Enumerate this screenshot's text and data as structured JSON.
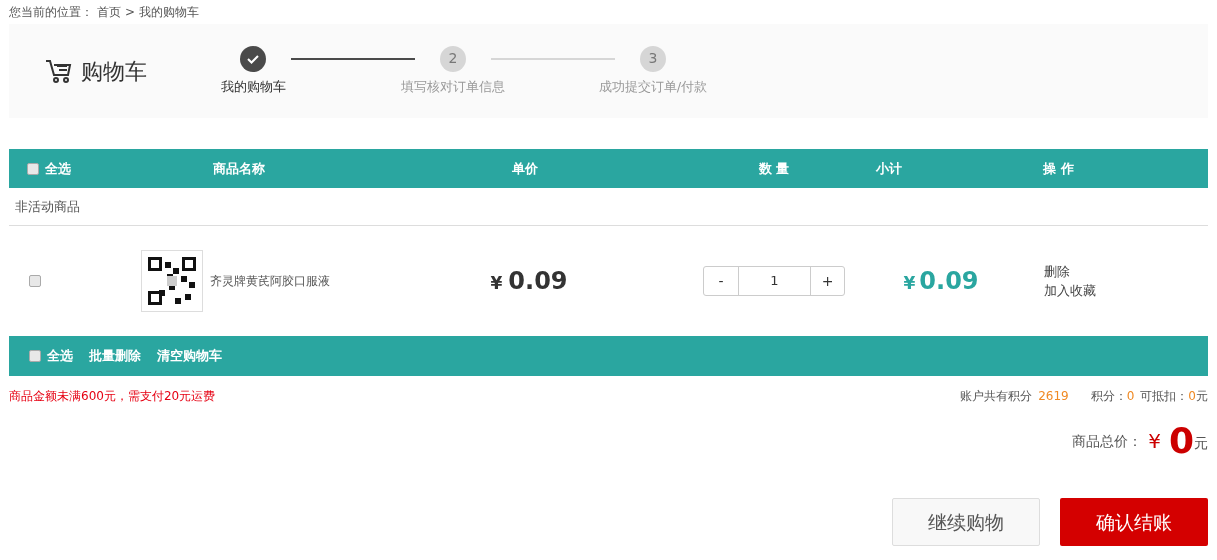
{
  "breadcrumb": {
    "label": "您当前的位置：",
    "items": [
      "首页",
      "我的购物车"
    ],
    "separator": ">"
  },
  "cart_title": "购物车",
  "steps": [
    {
      "label": "我的购物车",
      "done": true
    },
    {
      "number": "2",
      "label": "填写核对订单信息",
      "done": false
    },
    {
      "number": "3",
      "label": "成功提交订单/付款",
      "done": false
    }
  ],
  "table": {
    "select_all": {
      "label": "全选",
      "checked": false
    },
    "columns": [
      "商品名称",
      "单价",
      "数 量",
      "小计",
      "操 作"
    ]
  },
  "group_label": "非活动商品",
  "items": [
    {
      "checked": false,
      "image": {
        "kind": "picture"
      },
      "name": "齐灵牌黄芪阿胶口服液",
      "currency": "¥",
      "price": "0.09",
      "minus": "-",
      "quantity": "1",
      "plus": "+",
      "subtotal_currency": "¥",
      "subtotal": "0.09",
      "actions": [
        "删除",
        "加入收藏"
      ]
    }
  ],
  "footer_bar": {
    "select_all": {
      "label": "全选",
      "checked": false
    },
    "actions": [
      "批量删除",
      "清空购物车"
    ]
  },
  "shipping_notice": "商品金额未满600元，需支付20元运费",
  "points": {
    "label": "账户共有积分",
    "value": "2619",
    "used_label": "积分：",
    "used": "0",
    "deduct_label": "可抵扣：",
    "deduct": "0",
    "unit": "元"
  },
  "total": {
    "label": "商品总价：",
    "currency": "¥",
    "value": "0",
    "unit": "元"
  },
  "buttons": [
    {
      "label": "继续购物",
      "kind": "secondary"
    },
    {
      "label": "确认结账",
      "kind": "primary"
    }
  ]
}
